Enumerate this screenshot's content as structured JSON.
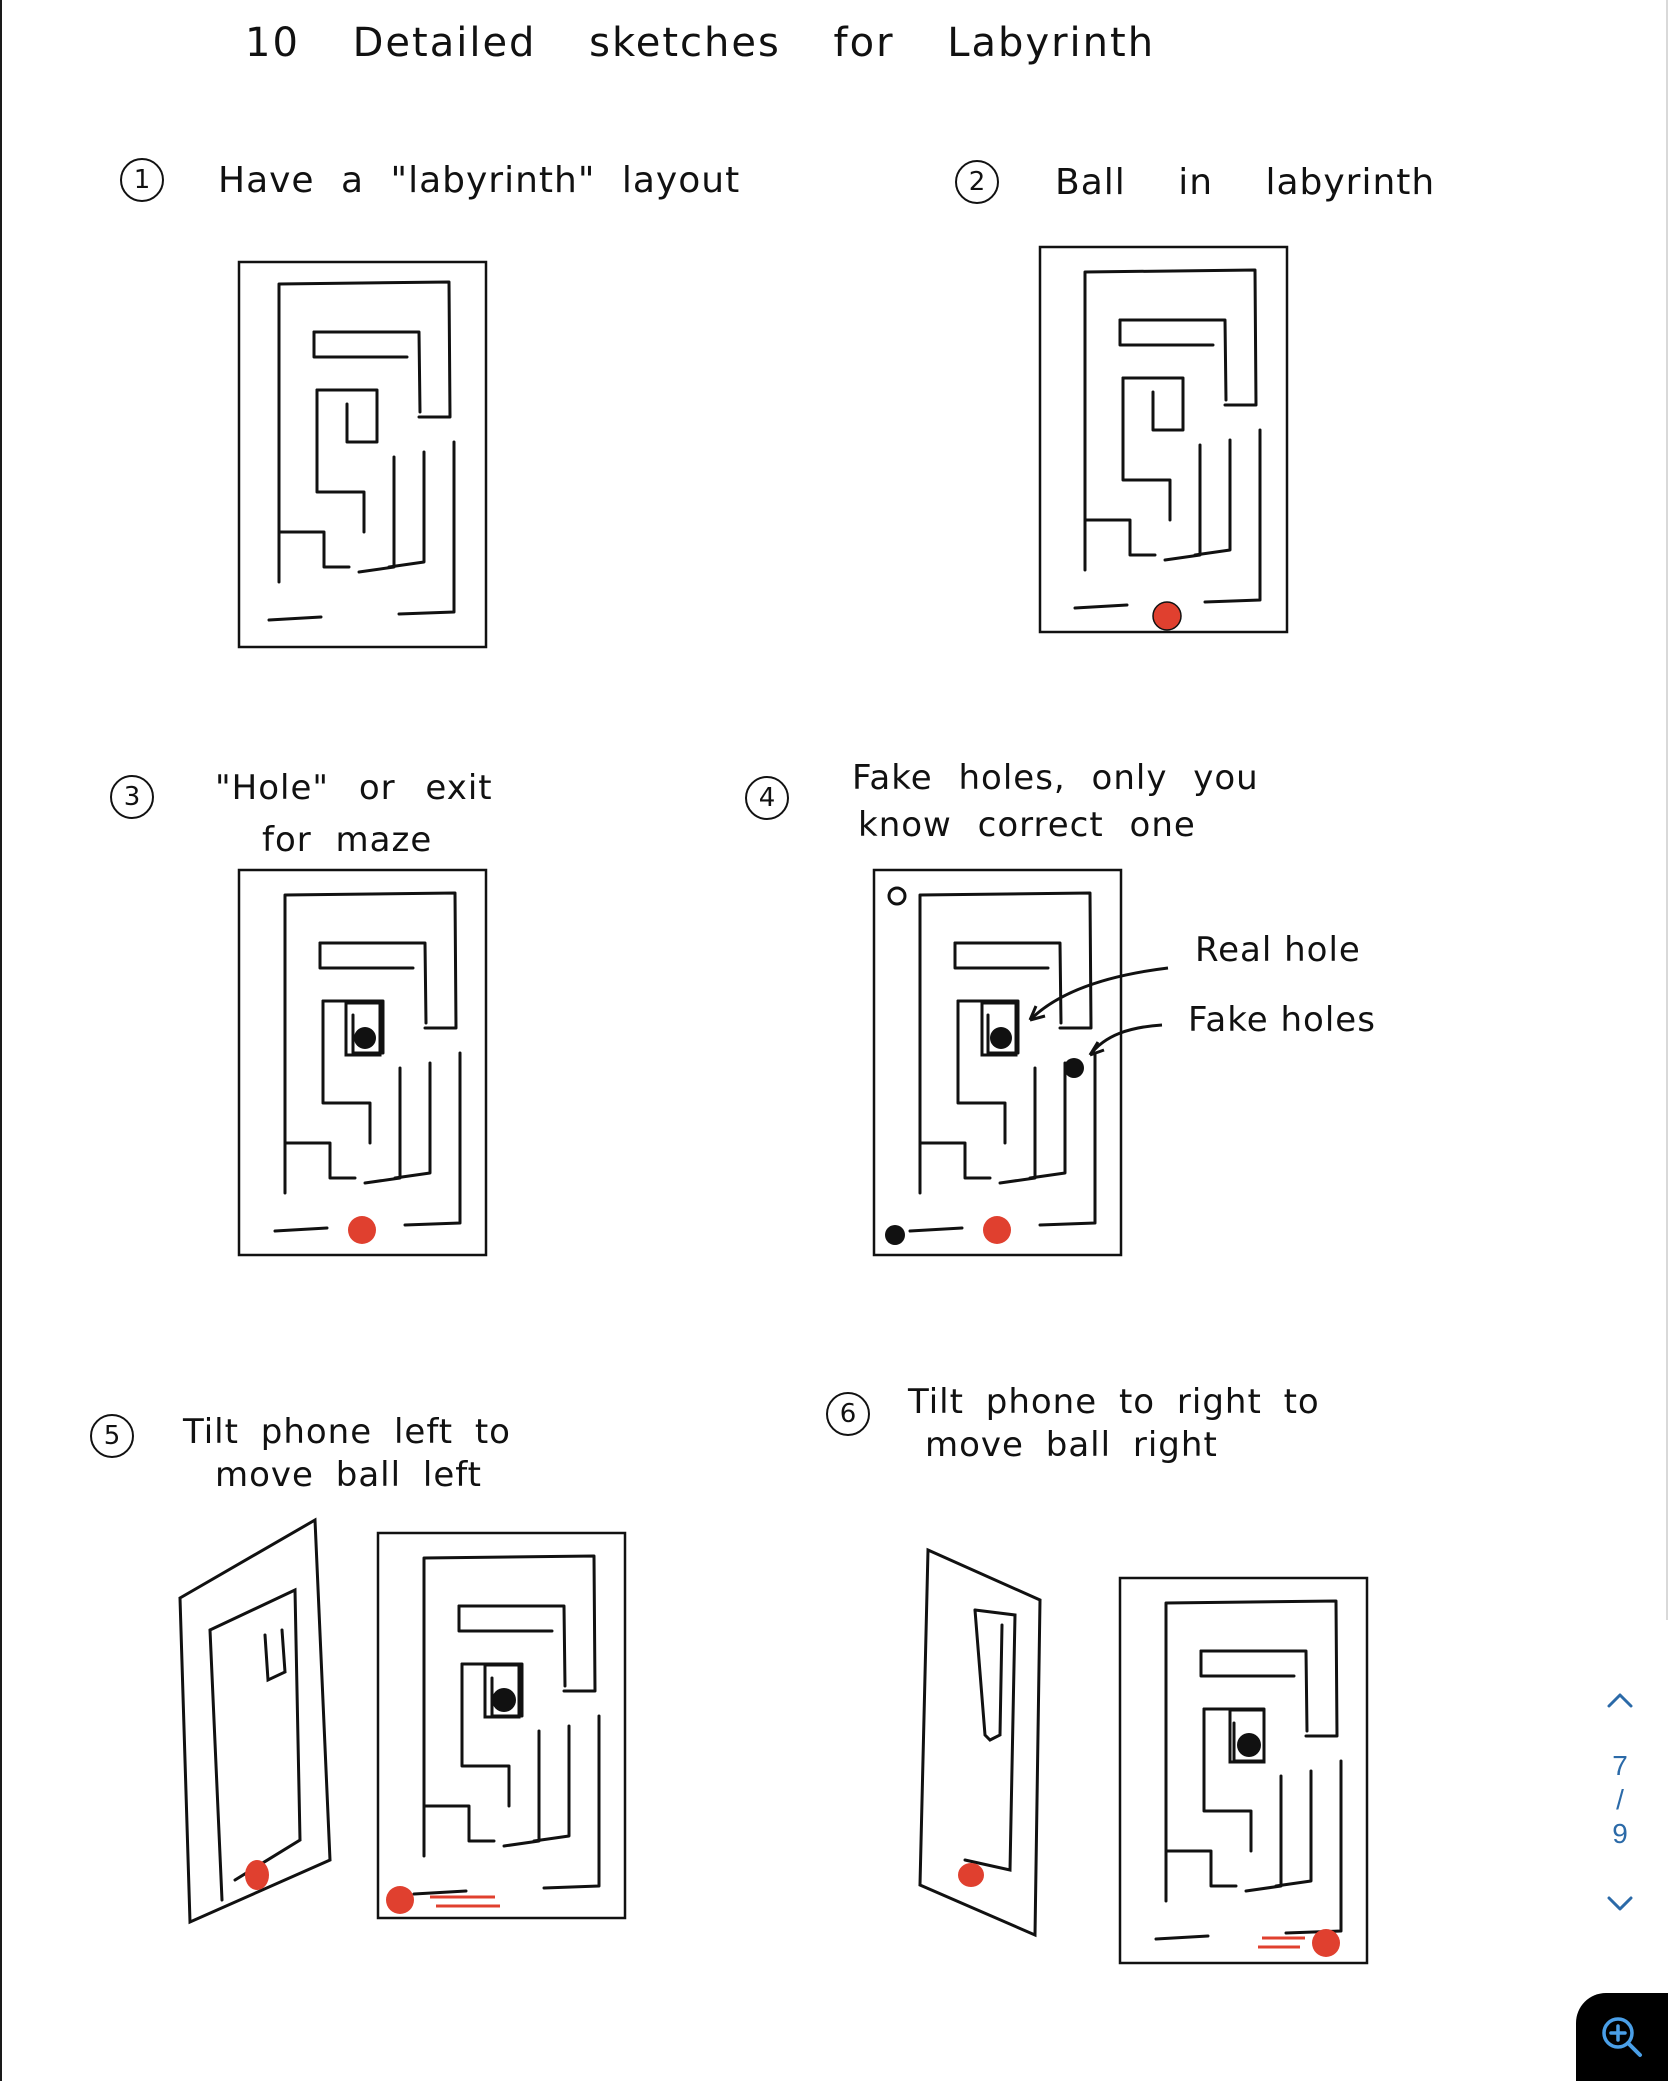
{
  "document": {
    "title": "10 Detailed sketches for Labyrinth",
    "sketches": [
      {
        "number": "1",
        "caption": "Have a \"labyrinth\" layout"
      },
      {
        "number": "2",
        "caption": "Ball in labyrinth"
      },
      {
        "number": "3",
        "caption_line1": "\"Hole\" or exit",
        "caption_line2": "for maze"
      },
      {
        "number": "4",
        "caption_line1": "Fake holes, only you",
        "caption_line2": "know correct one",
        "annotation_real": "Real hole",
        "annotation_fake": "Fake holes"
      },
      {
        "number": "5",
        "caption_line1": "Tilt phone left to",
        "caption_line2": "move ball left"
      },
      {
        "number": "6",
        "caption_line1": "Tilt phone to right to",
        "caption_line2": "move ball right"
      }
    ]
  },
  "pager": {
    "current": "7",
    "separator": "/",
    "total": "9"
  },
  "colors": {
    "ball": "#e0402f",
    "ink": "#111111",
    "pager": "#2b6aa8",
    "zoom_bg": "#000000"
  },
  "icons": {
    "prev": "chevron-up-icon",
    "next": "chevron-down-icon",
    "zoom": "zoom-in-icon"
  }
}
